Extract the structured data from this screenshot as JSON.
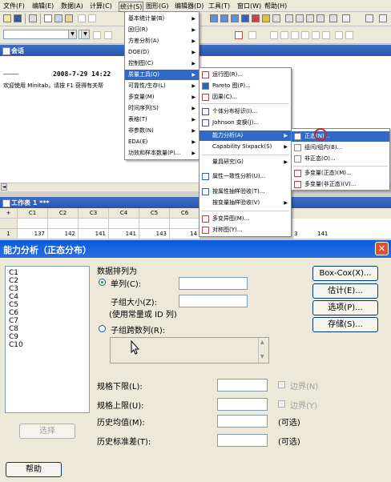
{
  "menubar": [
    "文件(F)",
    "编辑(E)",
    "数据(A)",
    "计算(C)",
    "统计(S)",
    "图形(G)",
    "编辑器(D)",
    "工具(T)",
    "窗口(W)",
    "帮助(H)"
  ],
  "session": {
    "title": "会话",
    "line1_dashes": "————",
    "line1_datetime": "2008-7-29 14:22",
    "line2": "欢迎使用 Minitab，请按 F1 获得有关帮"
  },
  "worksheet": {
    "title": "工作表 1 ***",
    "headers": [
      "+",
      "C1",
      "C2",
      "C3",
      "C4",
      "C5",
      "C6"
    ],
    "row": [
      "1",
      "137",
      "142",
      "141",
      "141",
      "143",
      "14"
    ],
    "row_tail": [
      "3",
      "141"
    ]
  },
  "stat_menu": [
    "基本统计量(B)",
    "回归(R)",
    "方差分析(A)",
    "DOE(D)",
    "控制图(C)",
    "质量工具(Q)",
    "可靠性/生存(L)",
    "多变量(M)",
    "时间序列(S)",
    "表格(T)",
    "非参数(N)",
    "EDA(E)",
    "功效和样本数量(P)..."
  ],
  "quality_menu": [
    "运行图(R)...",
    "Pareto 图(P)...",
    "因果(C)...",
    "个体分布标识(I)...",
    "Johnson 变换(J)...",
    "能力分析(A)",
    "Capability Sixpack(S)",
    "量具研究(G)",
    "属性一致性分析(U)...",
    "按属性抽样验收(T)...",
    "按变量抽样验收(V)",
    "多变异图(M)...",
    "对称图(Y)..."
  ],
  "capability_menu": [
    "正态(N)...",
    "组间/组内(B)...",
    "非正态(O)...",
    "多变量(正态)(M)...",
    "多变量(非正态)(V)..."
  ],
  "dialog": {
    "title": "能力分析（正态分布）",
    "variables": [
      "C1",
      "C2",
      "C3",
      "C4",
      "C5",
      "C6",
      "C7",
      "C8",
      "C9",
      "C10"
    ],
    "data_arranged_as": "数据排列为",
    "single_column": "单列(C):",
    "subgroup_size": "子组大小(Z):",
    "subgroup_note": "(使用常量或 ID 列)",
    "subgroups_across_rows": "子组跨数列(R):",
    "lsl": "规格下限(L):",
    "usl": "规格上限(U):",
    "boundary_lower": "边界(N)",
    "boundary_upper": "边界(Y)",
    "hist_mean": "历史均值(M):",
    "hist_sd": "历史标准差(T):",
    "optional1": "(可选)",
    "optional2": "(可选)",
    "select_btn": "选择",
    "help_btn": "帮助",
    "buttons": [
      "Box-Cox(X)...",
      "估计(E)...",
      "选项(P)...",
      "存储(S)..."
    ]
  }
}
